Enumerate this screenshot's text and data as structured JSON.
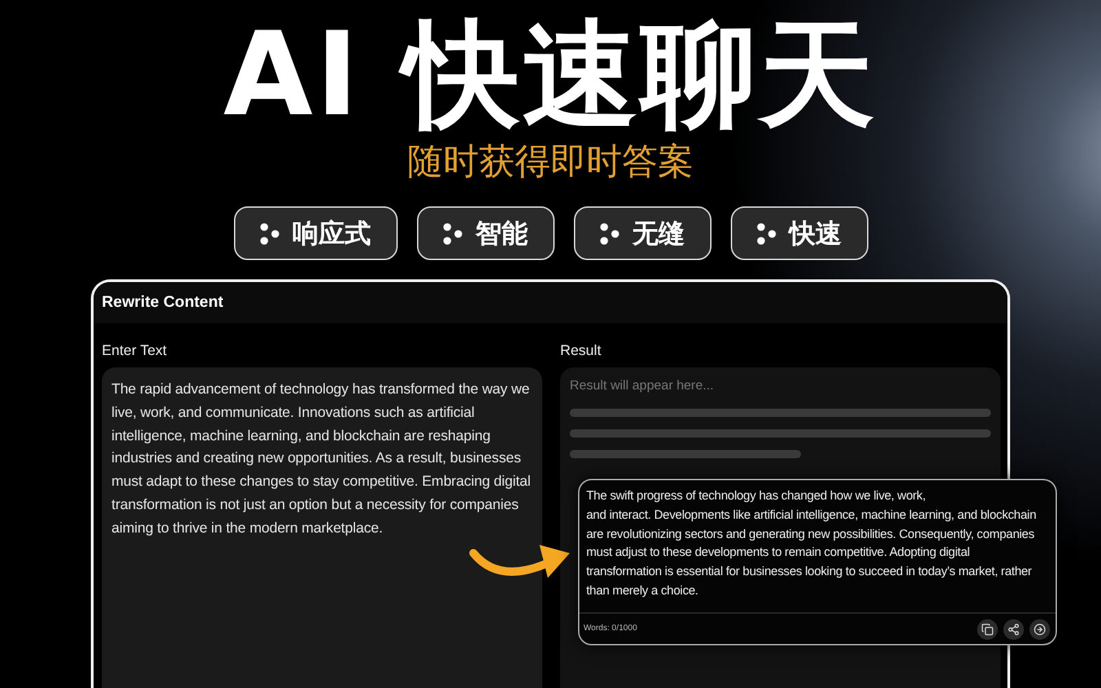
{
  "headline": "AI 快速聊天",
  "subtitle": "随时获得即时答案",
  "features": [
    {
      "label": "响应式"
    },
    {
      "label": "智能"
    },
    {
      "label": "无缝"
    },
    {
      "label": "快速"
    }
  ],
  "app": {
    "title": "Rewrite Content",
    "input": {
      "label": "Enter Text",
      "value": "The rapid advancement of technology has transformed the way we live, work, and communicate. Innovations such as artificial intelligence, machine learning, and blockchain are reshaping industries and creating new opportunities. As a result, businesses must adapt to these changes to stay competitive. Embracing digital transformation is not just an option but a necessity for companies aiming to thrive in the modern marketplace."
    },
    "result": {
      "label": "Result",
      "placeholder": "Result will appear here..."
    },
    "result_card": {
      "text": "The swift progress of technology has changed how we live, work,\nand interact. Developments like artificial intelligence, machine learning, and blockchain are revolutionizing sectors and generating new possibilities. Consequently, companies must adjust to these developments to remain competitive. Adopting digital transformation is essential for businesses looking to succeed in today’s market, rather than merely a choice.",
      "word_count": "Words: 0/1000"
    }
  }
}
